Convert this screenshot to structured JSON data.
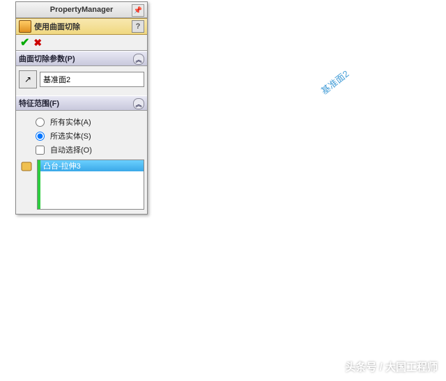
{
  "header": {
    "title": "PropertyManager"
  },
  "command": {
    "title": "使用曲面切除",
    "help": "?"
  },
  "buttons": {
    "ok": "✔",
    "cancel": "✖"
  },
  "groups": {
    "params": {
      "title": "曲面切除参数(P)",
      "selection": "基准面2",
      "collapse": "︽"
    },
    "scope": {
      "title": "特征范围(F)",
      "collapse": "︽",
      "opt_all": "所有实体(A)",
      "opt_sel": "所选实体(S)",
      "opt_auto": "自动选择(O)",
      "list_item": "凸台-拉伸3"
    }
  },
  "viewport": {
    "plane_label": "基准面2",
    "watermark": "头条号 / 大国工程师"
  },
  "icons": {
    "pin": "📌",
    "arrow": "↗"
  }
}
